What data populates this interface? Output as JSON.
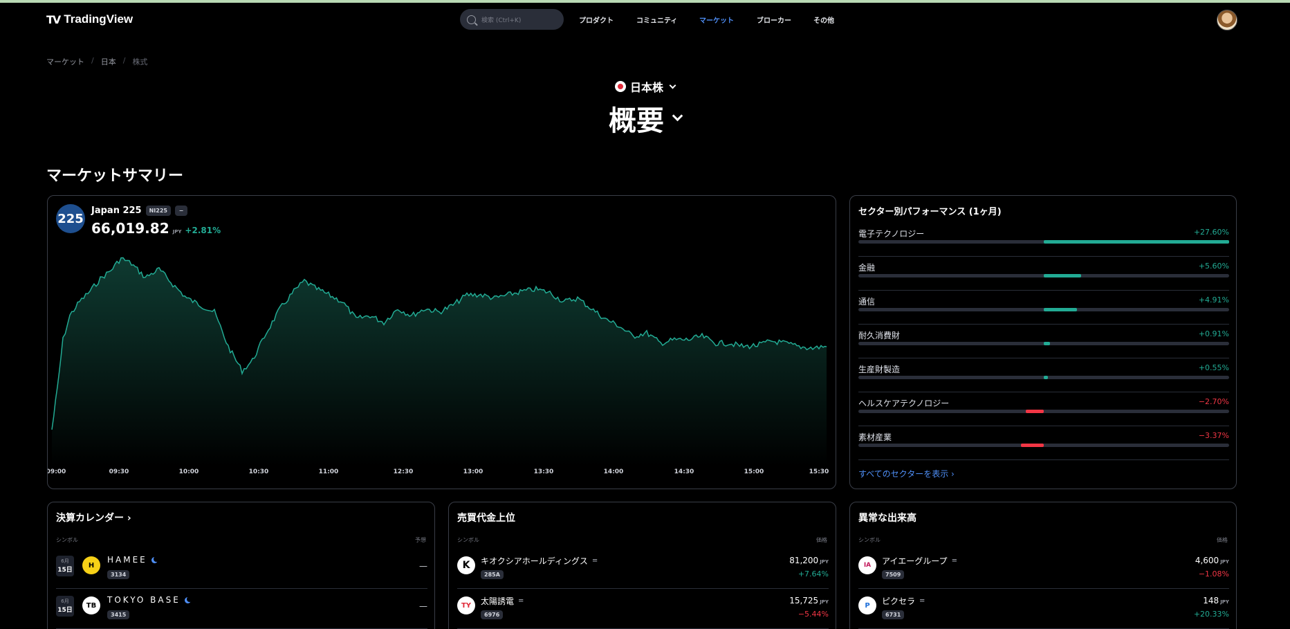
{
  "header": {
    "logo_text": "TradingView",
    "search_placeholder": "検索 (Ctrl+K)",
    "nav": [
      "プロダクト",
      "コミュニティ",
      "マーケット",
      "ブローカー",
      "その他"
    ],
    "active_nav": "マーケット"
  },
  "breadcrumb": [
    "マーケット",
    "日本",
    "株式"
  ],
  "market_selector": "日本株",
  "page_title": "概要",
  "section_title": "マーケットサマリー",
  "summary": {
    "badge": "225",
    "name": "Japan 225",
    "ticker": "NI225",
    "price": "66,019.82",
    "currency": "JPY",
    "change": "+2.81%",
    "times": [
      "09:00",
      "09:30",
      "10:00",
      "10:30",
      "11:00",
      "12:30",
      "13:00",
      "13:30",
      "14:00",
      "14:30",
      "15:00",
      "15:30"
    ],
    "accent": "#22ab94"
  },
  "sectors": {
    "title": "セクター別パフォーマンス (1ヶ月)",
    "items": [
      {
        "name": "電子テクノロジー",
        "change": "+27.60%",
        "value": 27.6
      },
      {
        "name": "金融",
        "change": "+5.60%",
        "value": 5.6
      },
      {
        "name": "通信",
        "change": "+4.91%",
        "value": 4.91
      },
      {
        "name": "耐久消費財",
        "change": "+0.91%",
        "value": 0.91
      },
      {
        "name": "生産財製造",
        "change": "+0.55%",
        "value": 0.55
      },
      {
        "name": "ヘルスケアテクノロジー",
        "change": "−2.70%",
        "value": -2.7
      },
      {
        "name": "素材産業",
        "change": "−3.37%",
        "value": -3.37
      }
    ],
    "show_all": "すべてのセクターを表示 ›"
  },
  "earnings": {
    "title": "決算カレンダー ›",
    "col_symbol": "シンボル",
    "col_est": "予想",
    "rows": [
      {
        "month": "6月",
        "day": "15日",
        "logo": "H",
        "name": "HAMEE",
        "code": "3134",
        "value": "—"
      },
      {
        "month": "6月",
        "day": "15日",
        "logo": "TB",
        "name": "TOKYO BASE",
        "code": "3415",
        "value": "—"
      }
    ]
  },
  "trading_value": {
    "title": "売買代金上位",
    "col_symbol": "シンボル",
    "col_price": "価格",
    "rows": [
      {
        "logo": "K",
        "name": "キオクシアホールディングス",
        "code": "285A",
        "price": "81,200",
        "currency": "JPY",
        "change": "+7.64%",
        "dir": "pos"
      },
      {
        "logo": "TY",
        "name": "太陽誘電",
        "code": "6976",
        "price": "15,725",
        "currency": "JPY",
        "change": "−5.44%",
        "dir": "neg"
      }
    ]
  },
  "abnormal_volume": {
    "title": "異常な出来高",
    "col_symbol": "シンボル",
    "col_price": "価格",
    "rows": [
      {
        "logo": "IA",
        "name": "アイエーグループ",
        "code": "7509",
        "price": "4,600",
        "currency": "JPY",
        "change": "−1.08%",
        "dir": "neg"
      },
      {
        "logo": "P",
        "name": "ピクセラ",
        "code": "6731",
        "price": "148",
        "currency": "JPY",
        "change": "+20.33%",
        "dir": "pos"
      }
    ]
  },
  "colors": {
    "up": "#22ab94",
    "down": "#f23645",
    "link": "#4f8ff7"
  }
}
